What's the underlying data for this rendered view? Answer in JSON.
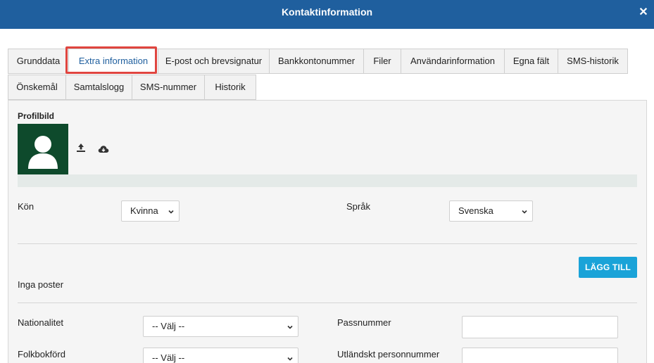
{
  "window": {
    "title": "Kontaktinformation",
    "close_glyph": "✕"
  },
  "tabs": {
    "row1": [
      "Grunddata",
      "Extra information",
      "E-post och brevsignatur",
      "Bankkontonummer",
      "Filer",
      "Användarinformation",
      "Egna fält",
      "SMS-historik"
    ],
    "row2": [
      "Önskemål",
      "Samtalslogg",
      "SMS-nummer",
      "Historik"
    ],
    "active": "Extra information"
  },
  "profile": {
    "label": "Profilbild",
    "upload_icon": "upload-icon",
    "download_icon": "cloud-download-icon"
  },
  "fields": {
    "gender_label": "Kön",
    "gender_value": "Kvinna",
    "language_label": "Språk",
    "language_value": "Svenska",
    "add_button": "LÄGG TILL",
    "no_posts": "Inga poster",
    "nationality_label": "Nationalitet",
    "nationality_value": "-- Välj --",
    "passport_label": "Passnummer",
    "passport_value": "",
    "registered_label": "Folkbokförd",
    "registered_value": "-- Välj --",
    "foreign_id_label": "Utländskt personnummer",
    "foreign_id_value": ""
  },
  "colors": {
    "header": "#1f5f9e",
    "accent_button": "#1aa3d8",
    "highlight": "#e0453f",
    "avatar_bg": "#0e4a2c"
  }
}
